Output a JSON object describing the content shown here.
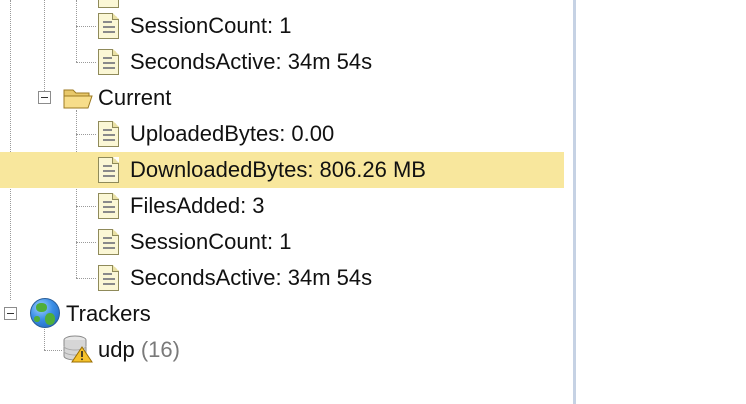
{
  "tree": {
    "top_items": [
      {
        "key": "SessionCount",
        "value": "1",
        "text": "SessionCount: 1"
      },
      {
        "key": "SecondsActive",
        "value": "34m 54s",
        "text": "SecondsActive: 34m 54s"
      }
    ],
    "current_folder": {
      "label": "Current",
      "items": [
        {
          "text": "UploadedBytes: 0.00"
        },
        {
          "text": "DownloadedBytes: 806.26 MB",
          "selected": true
        },
        {
          "text": "FilesAdded: 3"
        },
        {
          "text": "SessionCount: 1"
        },
        {
          "text": "SecondsActive: 34m 54s"
        }
      ]
    },
    "trackers": {
      "label": "Trackers",
      "children": [
        {
          "name": "udp",
          "count": "(16)"
        }
      ]
    }
  },
  "icons": {
    "item": "document-icon",
    "folder": "open-folder-icon",
    "trackers": "globe-icon",
    "tracker_child": "database-warning-icon",
    "toggle": "collapse-icon"
  },
  "colors": {
    "selection": "#f8e79d",
    "count_text": "#7a7a7a",
    "splitter": "#c6d2e4"
  }
}
